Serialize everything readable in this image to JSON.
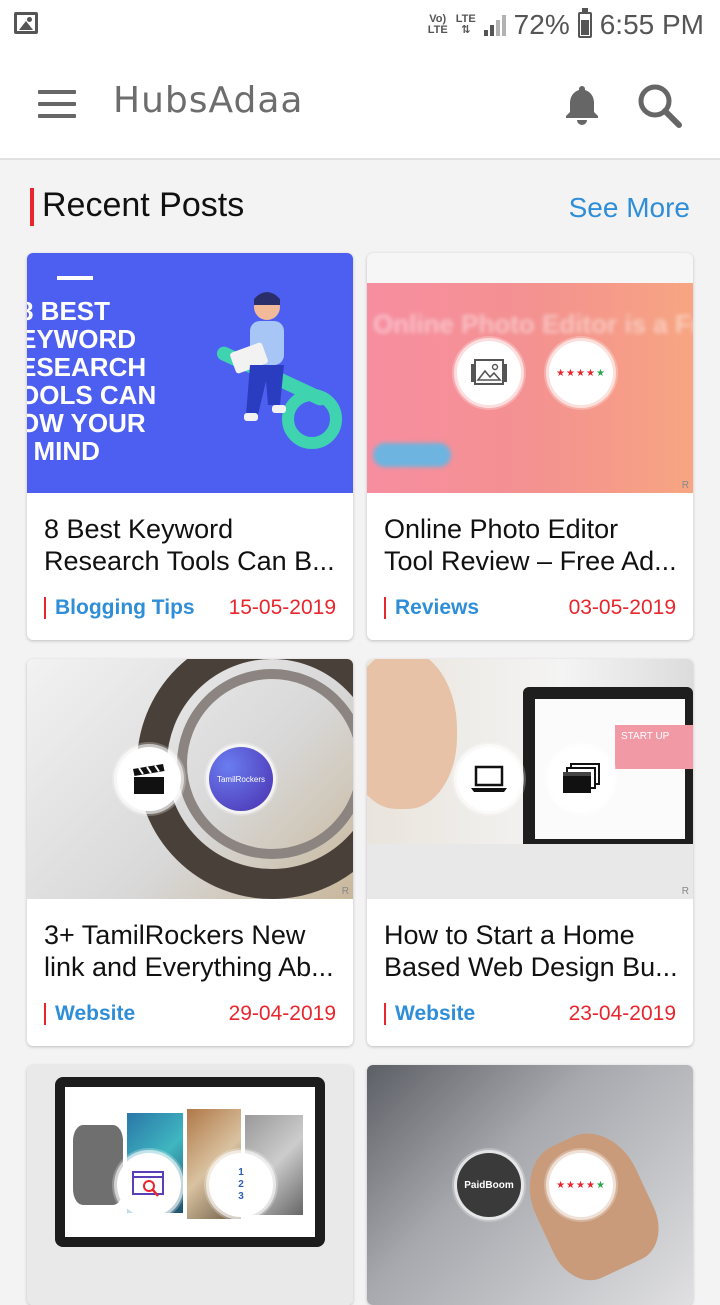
{
  "status_bar": {
    "volte": "Vo)\nLTE",
    "lte": "LTE",
    "battery": "72%",
    "time": "6:55 PM",
    "icons": [
      "gallery-icon",
      "volte-icon",
      "lte-icon",
      "signal-icon",
      "battery-icon"
    ]
  },
  "app_bar": {
    "title": "HubsAdaa",
    "icons": [
      "hamburger-menu-icon",
      "notification-bell-icon",
      "search-icon"
    ]
  },
  "section": {
    "title": "Recent Posts",
    "see_more": "See More",
    "accent_color": "#e8262e",
    "link_color": "#2f8ed8"
  },
  "posts": [
    {
      "thumb_text": "8 BEST\nEYWORD\nESEARCH\nOOLS CAN\nOW YOUR\n  MIND",
      "title_line1": "8 Best Keyword",
      "title_line2": "Research Tools Can B...",
      "category": "Blogging Tips",
      "date": "15-05-2019"
    },
    {
      "thumb_text": "Online Photo Editor is a Fr",
      "badge_rating": "★★★★",
      "badge_rating_last": "★",
      "title_line1": "Online Photo Editor",
      "title_line2": "Tool Review – Free Ad...",
      "category": "Reviews",
      "date": "03-05-2019"
    },
    {
      "badge_label": "TamilRockers",
      "title_line1": "3+ TamilRockers New",
      "title_line2": "link and Everything Ab...",
      "category": "Website",
      "date": "29-04-2019"
    },
    {
      "thumb_text": "START UP",
      "title_line1": "How to Start a Home",
      "title_line2": "Based Web Design Bu...",
      "category": "Website",
      "date": "23-04-2019"
    },
    {
      "badge_steps": "1\n2\n3"
    },
    {
      "badge_label": "PaidBoom",
      "badge_rating": "★★★★",
      "badge_rating_last": "★"
    }
  ],
  "corner_mark": "R"
}
